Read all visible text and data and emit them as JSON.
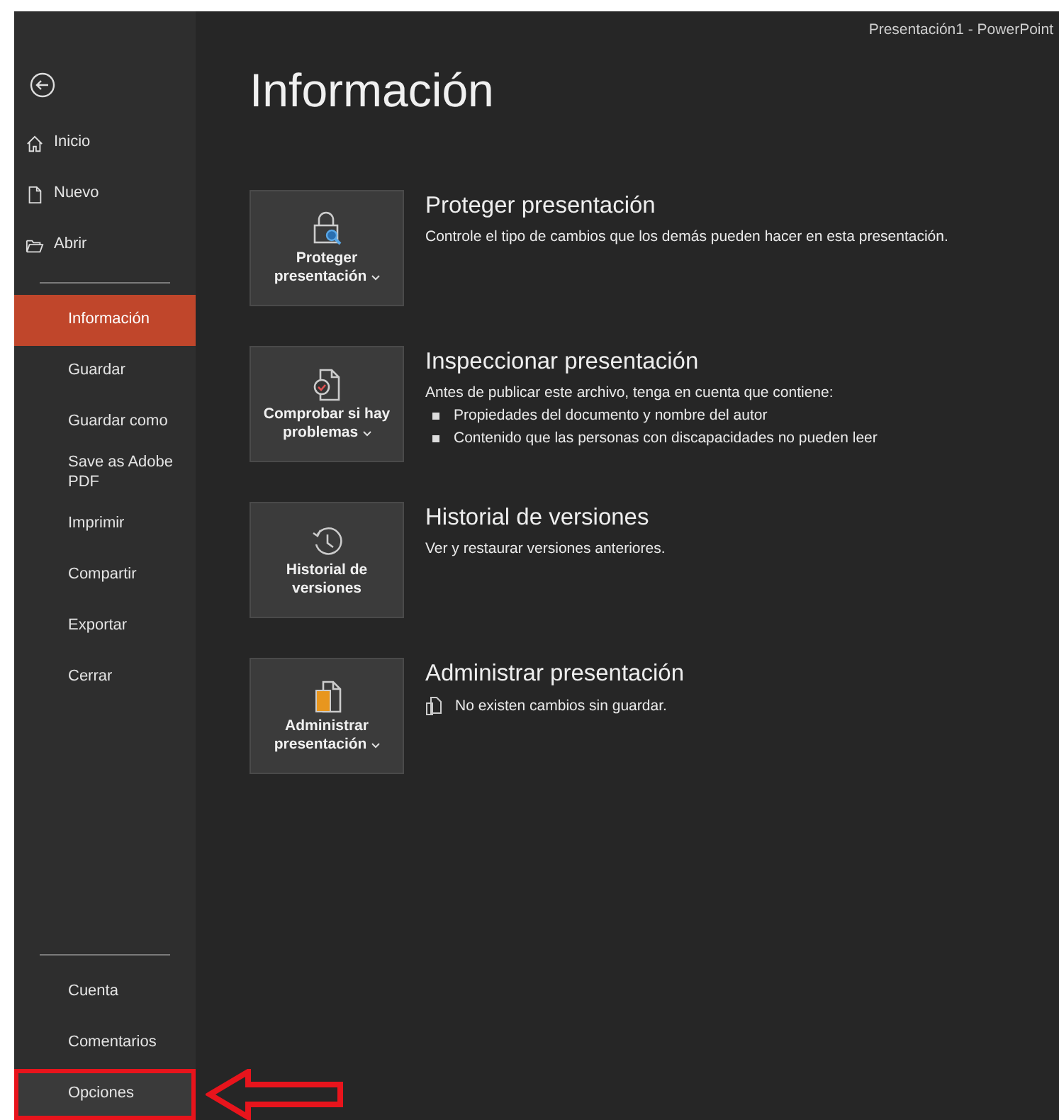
{
  "window": {
    "title": "Presentación1  -  PowerPoint"
  },
  "sidebar": {
    "top_items": [
      {
        "label": "Inicio",
        "kind": "home",
        "selected": false,
        "highlighted": false
      },
      {
        "label": "Nuevo",
        "kind": "new",
        "selected": false,
        "highlighted": false
      },
      {
        "label": "Abrir",
        "kind": "open",
        "selected": false,
        "highlighted": false
      },
      {
        "label": "Información",
        "kind": "plain",
        "selected": true,
        "highlighted": false
      },
      {
        "label": "Guardar",
        "kind": "plain",
        "selected": false,
        "highlighted": false
      },
      {
        "label": "Guardar como",
        "kind": "plain",
        "selected": false,
        "highlighted": false
      },
      {
        "label": "Save as Adobe PDF",
        "kind": "plain",
        "selected": false,
        "highlighted": false
      },
      {
        "label": "Imprimir",
        "kind": "plain",
        "selected": false,
        "highlighted": false
      },
      {
        "label": "Compartir",
        "kind": "plain",
        "selected": false,
        "highlighted": false
      },
      {
        "label": "Exportar",
        "kind": "plain",
        "selected": false,
        "highlighted": false
      },
      {
        "label": "Cerrar",
        "kind": "plain",
        "selected": false,
        "highlighted": false
      }
    ],
    "bottom_items": [
      {
        "label": "Cuenta",
        "kind": "plain",
        "selected": false,
        "highlighted": false
      },
      {
        "label": "Comentarios",
        "kind": "plain",
        "selected": false,
        "highlighted": false
      },
      {
        "label": "Opciones",
        "kind": "plain",
        "selected": false,
        "highlighted": true
      }
    ]
  },
  "page_title": "Información",
  "sections": [
    {
      "kind": "protect",
      "button": "Proteger presentación",
      "dropdown": true,
      "heading": "Proteger presentación",
      "lines": [
        {
          "kind": "plain",
          "text": "Controle el tipo de cambios que los demás pueden hacer en esta presentación."
        }
      ]
    },
    {
      "kind": "inspect",
      "button": "Comprobar si hay problemas",
      "dropdown": true,
      "heading": "Inspeccionar presentación",
      "lines": [
        {
          "kind": "plain",
          "text": "Antes de publicar este archivo, tenga en cuenta que contiene:"
        },
        {
          "kind": "bullet",
          "text": "Propiedades del documento y nombre del autor"
        },
        {
          "kind": "bullet",
          "text": "Contenido que las personas con discapacidades no pueden leer"
        }
      ]
    },
    {
      "kind": "history",
      "button": "Historial de versiones",
      "dropdown": false,
      "heading": "Historial de versiones",
      "lines": [
        {
          "kind": "plain",
          "text": "Ver y restaurar versiones anteriores."
        }
      ]
    },
    {
      "kind": "manage",
      "button": "Administrar presentación",
      "dropdown": true,
      "heading": "Administrar presentación",
      "lines": [
        {
          "kind": "file",
          "text": "No existen cambios sin guardar."
        }
      ]
    }
  ]
}
